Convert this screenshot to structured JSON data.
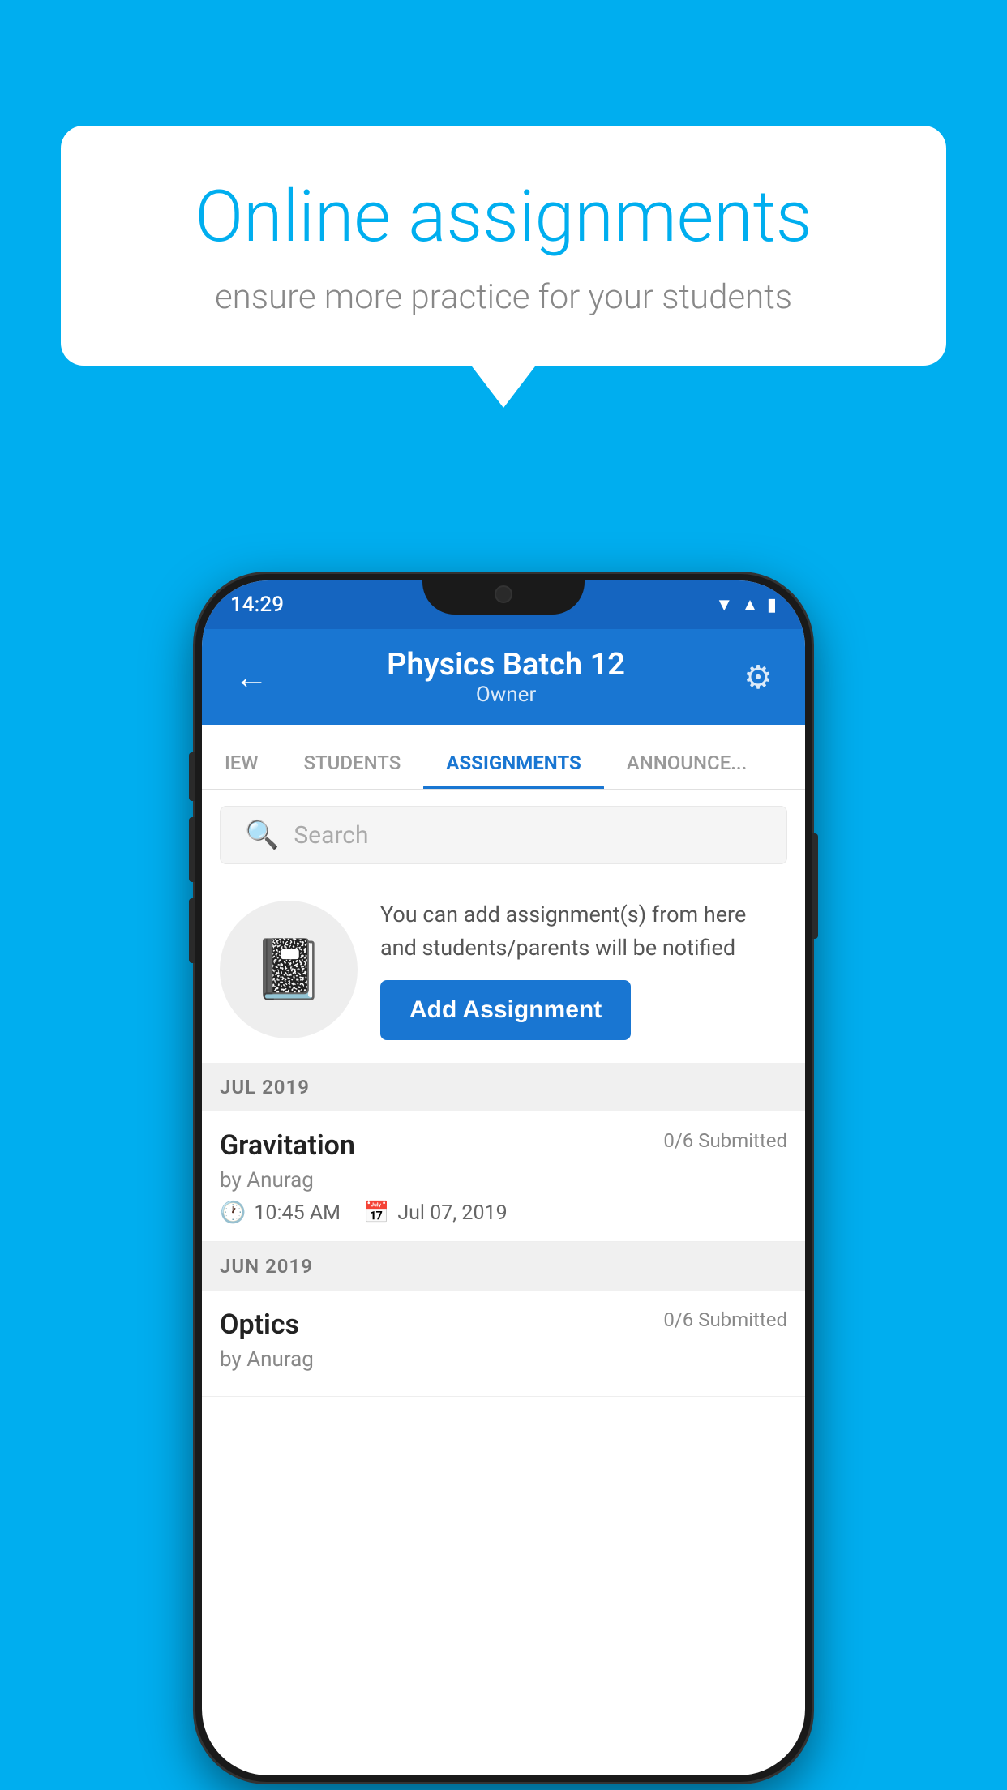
{
  "background": {
    "color": "#00AEEF"
  },
  "speech_bubble": {
    "title": "Online assignments",
    "subtitle": "ensure more practice for your students"
  },
  "status_bar": {
    "time": "14:29",
    "wifi": "▾",
    "signal": "▲",
    "battery": "▮"
  },
  "header": {
    "title": "Physics Batch 12",
    "subtitle": "Owner",
    "back_label": "←",
    "settings_label": "⚙"
  },
  "tabs": [
    {
      "label": "IEW",
      "active": false
    },
    {
      "label": "STUDENTS",
      "active": false
    },
    {
      "label": "ASSIGNMENTS",
      "active": true
    },
    {
      "label": "ANNOUNCEMENTS",
      "active": false
    }
  ],
  "search": {
    "placeholder": "Search"
  },
  "promo": {
    "text": "You can add assignment(s) from here and students/parents will be notified",
    "button_label": "Add Assignment"
  },
  "sections": [
    {
      "label": "JUL 2019",
      "assignments": [
        {
          "name": "Gravitation",
          "submitted": "0/6 Submitted",
          "by": "by Anurag",
          "time": "10:45 AM",
          "date": "Jul 07, 2019"
        }
      ]
    },
    {
      "label": "JUN 2019",
      "assignments": [
        {
          "name": "Optics",
          "submitted": "0/6 Submitted",
          "by": "by Anurag",
          "time": "",
          "date": ""
        }
      ]
    }
  ]
}
